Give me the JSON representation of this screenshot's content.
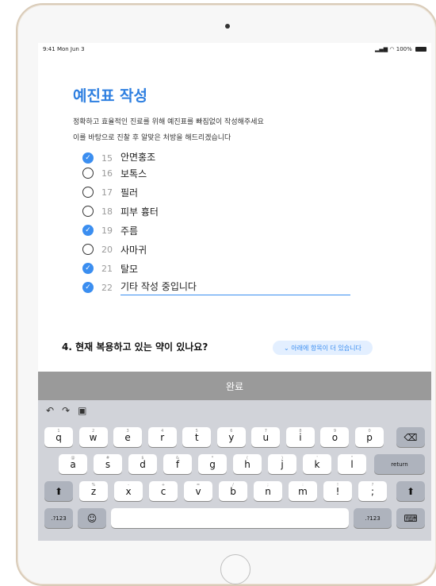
{
  "status": {
    "time": "9:41 Mon Jun 3",
    "battery": "100%"
  },
  "form": {
    "title": "예진표 작성",
    "desc_line1": "정확하고 효율적인 진료를 위해 예진표를 빠짐없이 작성해주세요",
    "desc_line2": "이를 바탕으로 진찰 후 알맞은 처방을 해드리겠습니다",
    "items": [
      {
        "num": "15",
        "label": "안면홍조",
        "checked": true
      },
      {
        "num": "16",
        "label": "보톡스",
        "checked": false
      },
      {
        "num": "17",
        "label": "필러",
        "checked": false
      },
      {
        "num": "18",
        "label": "피부 흉터",
        "checked": false
      },
      {
        "num": "19",
        "label": "주름",
        "checked": true
      },
      {
        "num": "20",
        "label": "사마귀",
        "checked": false
      },
      {
        "num": "21",
        "label": "탈모",
        "checked": true
      },
      {
        "num": "22",
        "label": "기타 작성 중입니다",
        "checked": true
      }
    ],
    "question4": "4. 현재 복용하고 있는 약이 있나요?",
    "more_pill": "⌄ 아래에 항목이 더 있습니다"
  },
  "keyboard": {
    "done_label": "완료",
    "row1": [
      "q",
      "w",
      "e",
      "r",
      "t",
      "y",
      "u",
      "i",
      "o",
      "p"
    ],
    "row1_hints": [
      "1",
      "2",
      "3",
      "4",
      "5",
      "6",
      "7",
      "8",
      "9",
      "0"
    ],
    "row2": [
      "a",
      "s",
      "d",
      "f",
      "g",
      "h",
      "j",
      "k",
      "l"
    ],
    "row2_hints": [
      "@",
      "#",
      "$",
      "&",
      "*",
      "(",
      ")",
      "'",
      "\""
    ],
    "row3": [
      "z",
      "x",
      "c",
      "v",
      "b",
      "n",
      "m",
      "!",
      ";"
    ],
    "row3_hints": [
      "%",
      "-",
      "+",
      "=",
      "/",
      ";",
      ":",
      "!",
      "?"
    ],
    "return_label": "return",
    "num_label": ".?123",
    "undo_icon": "undo-icon",
    "redo_icon": "redo-icon",
    "paste_icon": "clipboard-icon",
    "delete_icon": "delete-icon",
    "shift_icon": "shift-icon",
    "emoji_icon": "emoji-icon",
    "hide_icon": "keyboard-hide-icon"
  },
  "colors": {
    "accent": "#3b8ef0",
    "done_bar": "#9a9a9a",
    "keyboard_bg": "#d1d3d9",
    "frame": "#d9cbb8"
  }
}
